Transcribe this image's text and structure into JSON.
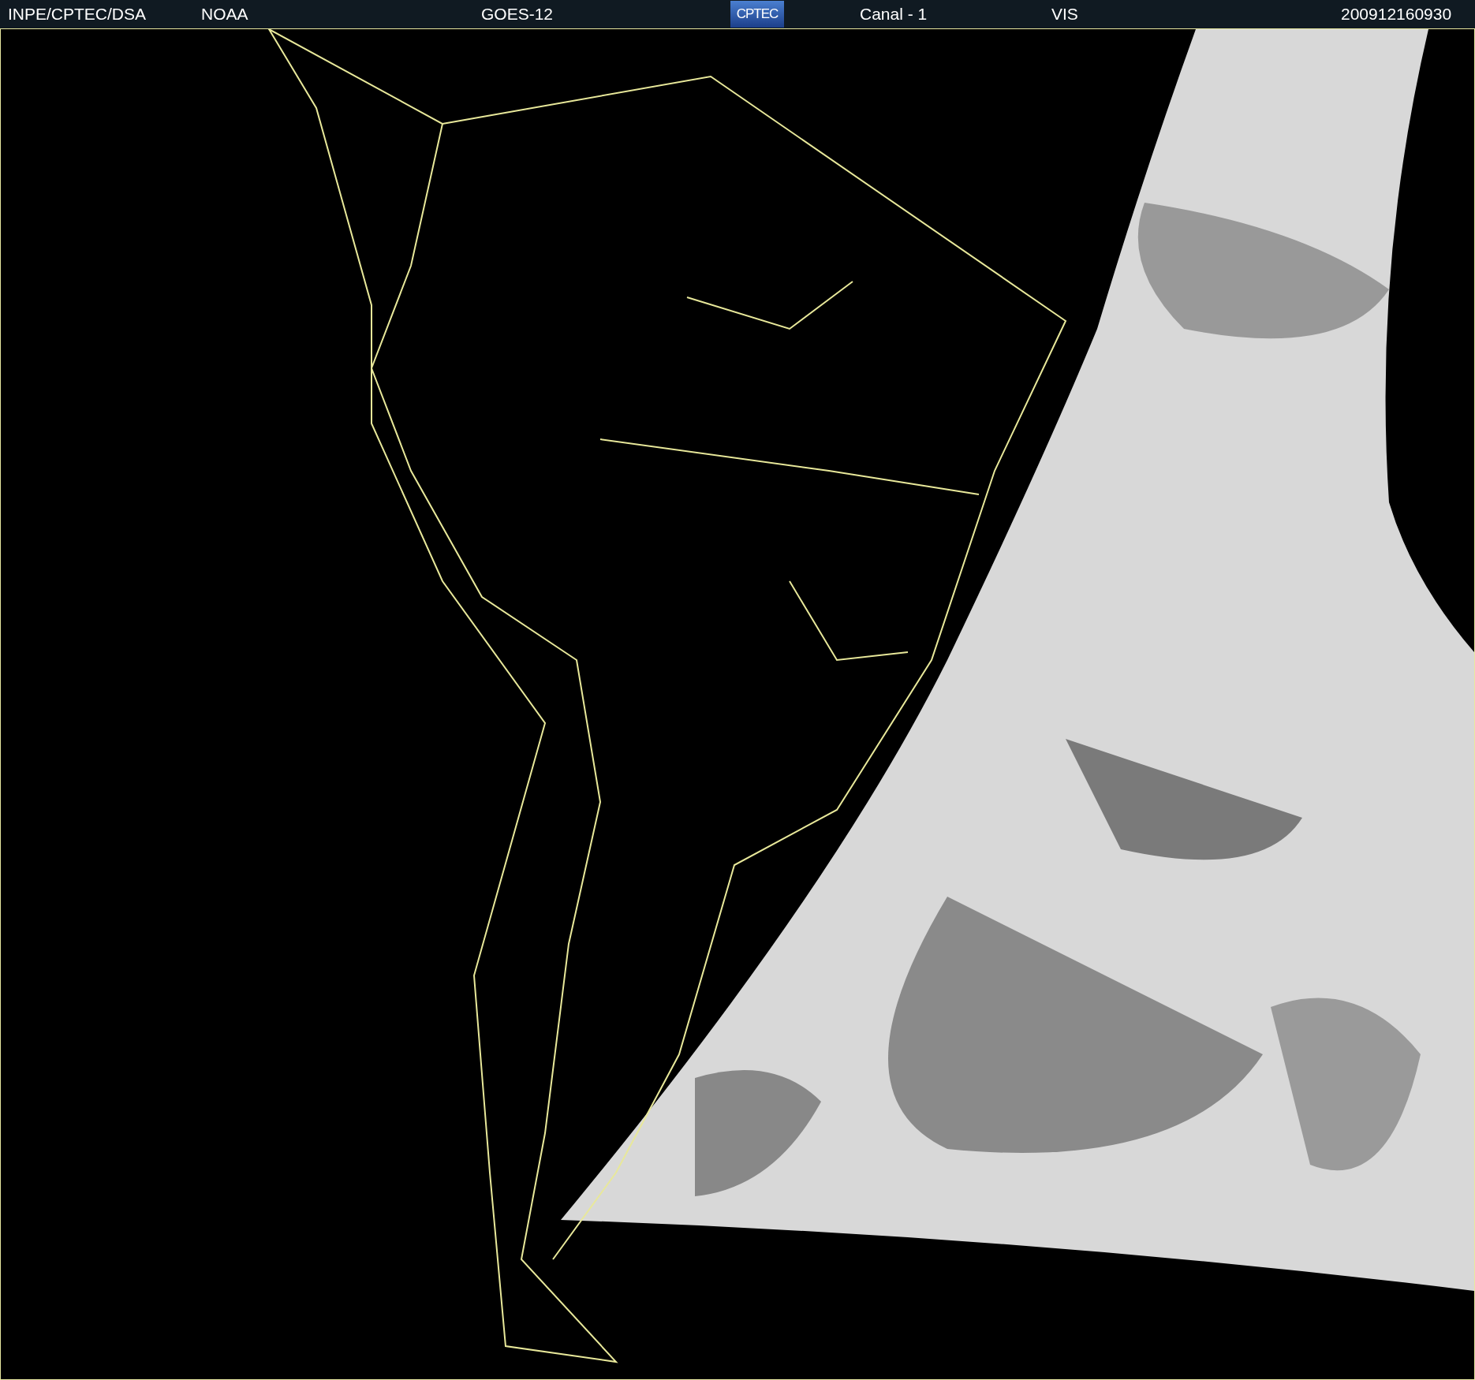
{
  "header": {
    "source": "INPE/CPTEC/DSA",
    "agency": "NOAA",
    "satellite": "GOES-12",
    "logo": "CPTEC",
    "channel": "Canal - 1",
    "band": "VIS",
    "timestamp": "200912160930"
  }
}
